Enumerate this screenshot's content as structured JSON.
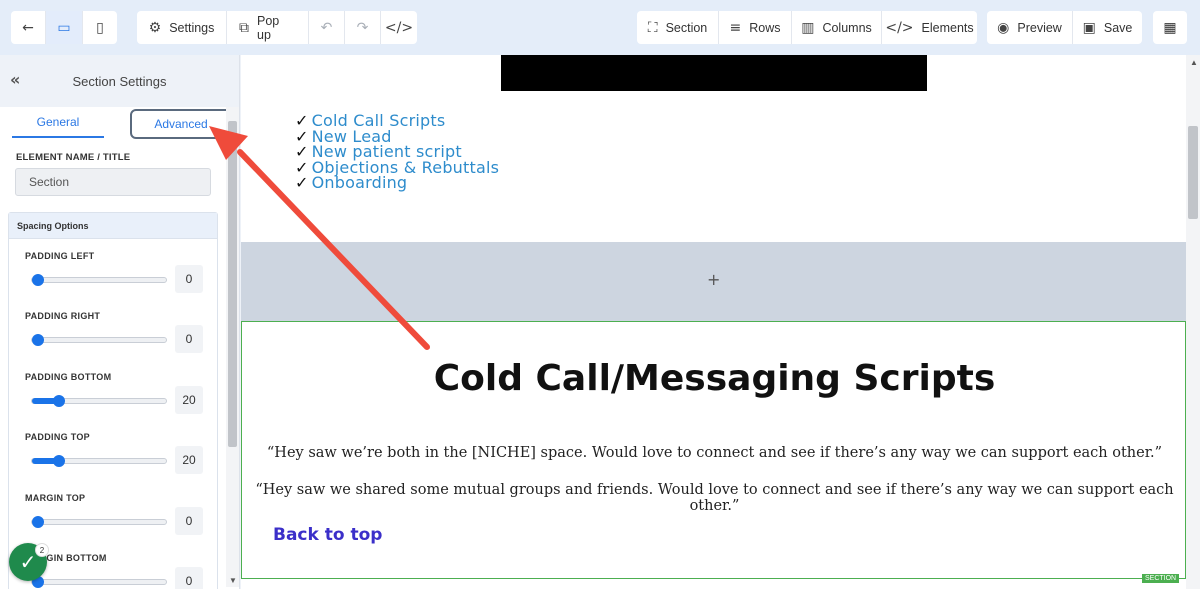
{
  "toolbar": {
    "left_buttons": [
      {
        "name": "back-button",
        "icon": "arrow-left-icon",
        "glyph": "←",
        "label": ""
      },
      {
        "name": "desktop-view-button",
        "icon": "desktop-icon",
        "glyph": "▭",
        "label": "",
        "active": true
      },
      {
        "name": "mobile-view-button",
        "icon": "mobile-icon",
        "glyph": "▯",
        "label": ""
      }
    ],
    "settings_label": "Settings",
    "popup_label": "Pop up",
    "section_label": "Section",
    "rows_label": "Rows",
    "columns_label": "Columns",
    "elements_label": "Elements",
    "preview_label": "Preview",
    "save_label": "Save"
  },
  "sidebar": {
    "title": "Section Settings",
    "tabs": {
      "general": "General",
      "advanced": "Advanced"
    },
    "element_name_label": "ELEMENT NAME / TITLE",
    "element_name_value": "Section",
    "spacing_title": "Spacing Options",
    "spacing": [
      {
        "label": "PADDING LEFT",
        "value": "0",
        "fraction": 0
      },
      {
        "label": "PADDING RIGHT",
        "value": "0",
        "fraction": 0
      },
      {
        "label": "PADDING BOTTOM",
        "value": "20",
        "fraction": 0.2
      },
      {
        "label": "PADDING TOP",
        "value": "20",
        "fraction": 0.2
      },
      {
        "label": "MARGIN TOP",
        "value": "0",
        "fraction": 0
      },
      {
        "label": "MARGIN BOTTOM",
        "value": "0",
        "fraction": 0
      }
    ],
    "badge_count": "2"
  },
  "canvas": {
    "links": [
      "Cold Call Scripts",
      "New Lead",
      "New patient script",
      "Objections & Rebuttals",
      "Onboarding"
    ],
    "add_symbol": "+",
    "section_title": "Cold Call/Messaging Scripts",
    "quote_1": "“Hey saw we’re both in the [NICHE] space. Would love to connect and see if there’s any way we can support each other.”",
    "quote_2": "“Hey saw we shared some mutual groups and friends. Would love to connect and see if there’s any way we can support each other.”",
    "back_to_top": "Back to top",
    "section_tag": "SECTION"
  },
  "colors": {
    "accent": "#2b78e4",
    "link": "#2e8ccc",
    "section_border": "#4caf50",
    "arrow": "#ef4b3b"
  }
}
